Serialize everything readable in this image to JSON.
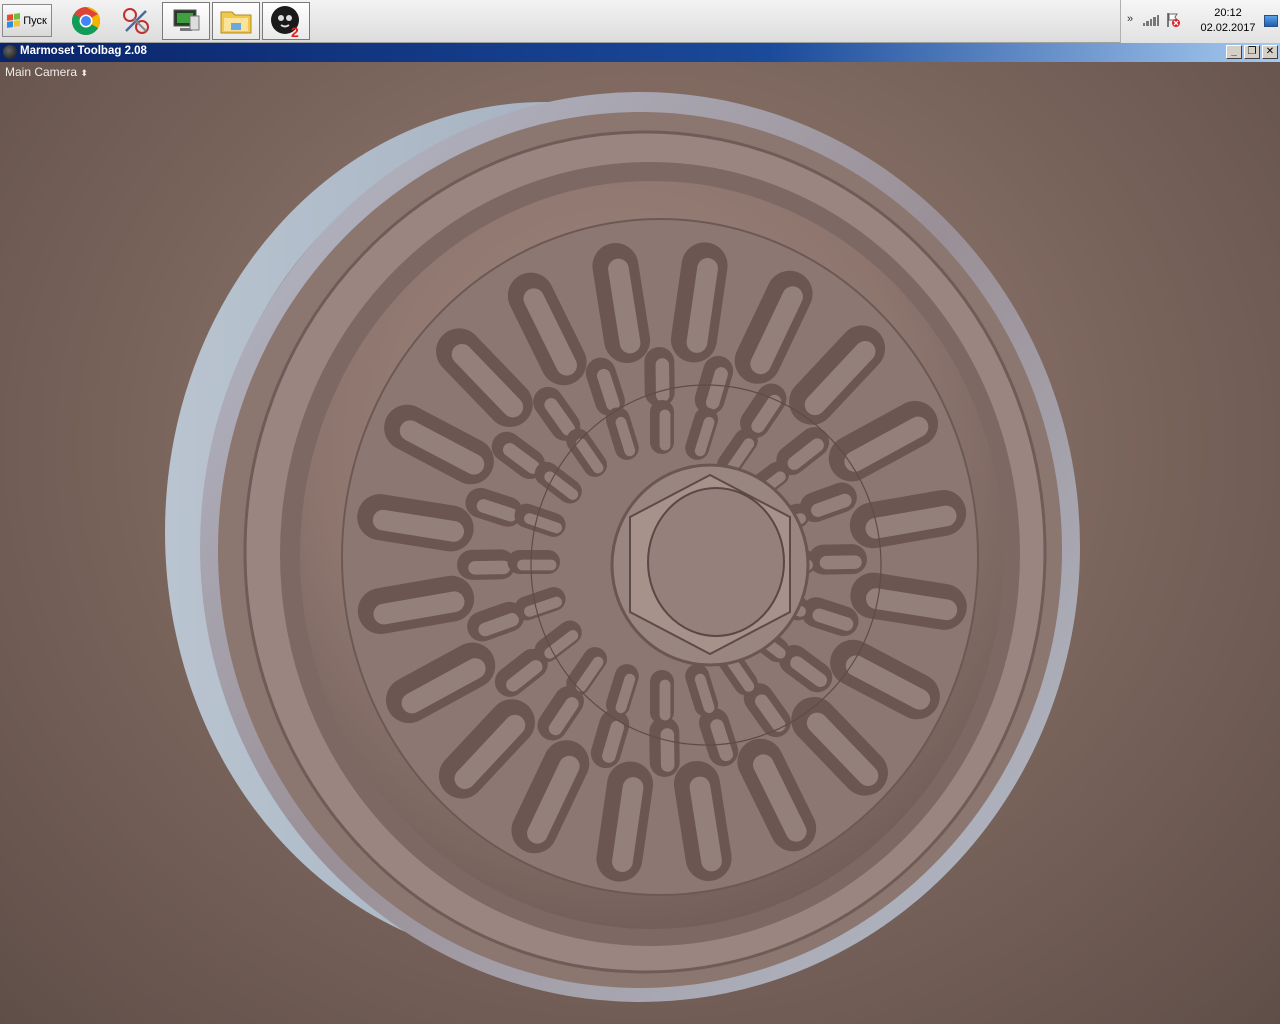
{
  "taskbar": {
    "start_label": "Пуск",
    "apps": [
      {
        "name": "chrome-icon"
      },
      {
        "name": "scissors-tool-icon"
      },
      {
        "name": "monitor-app-icon"
      },
      {
        "name": "file-explorer-icon"
      },
      {
        "name": "marmoset-icon"
      }
    ],
    "clock": {
      "time": "20:12",
      "date": "02.02.2017"
    }
  },
  "window": {
    "title": "Marmoset Toolbag 2.08",
    "controls": {
      "minimize": "_",
      "restore": "❐",
      "close": "✕"
    }
  },
  "viewport": {
    "camera_label": "Main Camera",
    "camera_arrow": "⬍"
  }
}
